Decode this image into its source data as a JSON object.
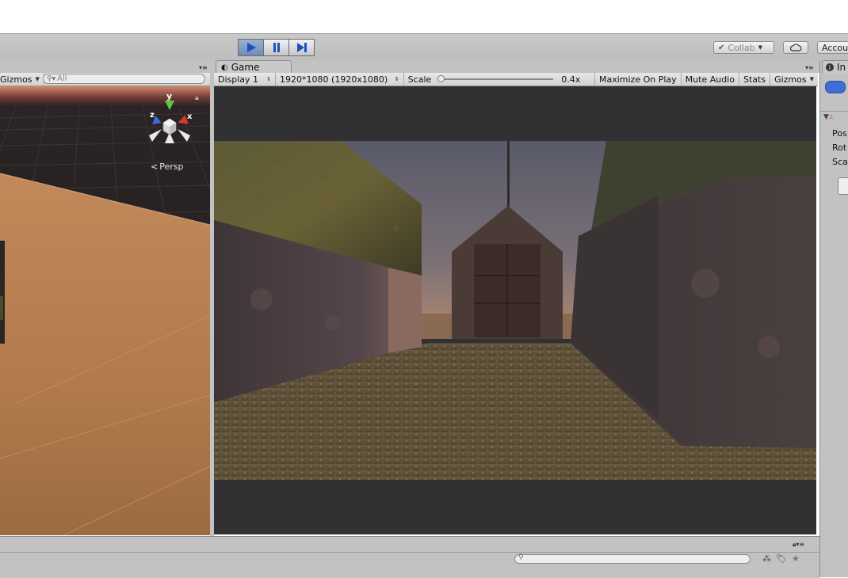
{
  "toolbar": {
    "play_icon": "play-icon",
    "pause_icon": "pause-icon",
    "step_icon": "step-icon",
    "collab_label": "Collab",
    "cloud_icon": "cloud-icon",
    "account_label": "Accou"
  },
  "scene": {
    "gizmos_label": "Gizmos",
    "search_placeholder": "All",
    "persp_label": "Persp",
    "axis_y": "y",
    "axis_x": "x",
    "axis_z": "z"
  },
  "game": {
    "tab_label": "Game",
    "display_label": "Display 1",
    "resolution_label": "1920*1080 (1920x1080)",
    "scale_label": "Scale",
    "scale_value_label": "0.4x",
    "scale_value": 0.4,
    "maximize_label": "Maximize On Play",
    "mute_label": "Mute Audio",
    "stats_label": "Stats",
    "gizmos_label": "Gizmos"
  },
  "inspector": {
    "tab_label": "In",
    "transform_rows": [
      "Pos",
      "Rot",
      "Sca"
    ]
  },
  "colors": {
    "accent": "#3f6fd6",
    "toolbar_bg": "#c2c2c2",
    "game_bg": "#313133"
  }
}
